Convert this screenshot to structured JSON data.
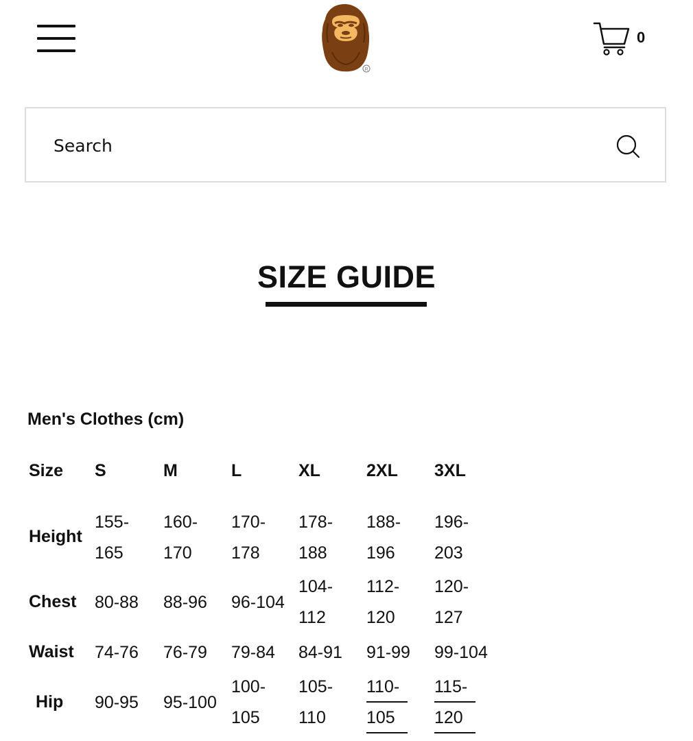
{
  "header": {
    "menu_icon": "hamburger-menu-icon",
    "logo_icon": "ape-head-logo",
    "logo_registered_mark": "®",
    "cart_icon": "shopping-cart-icon",
    "cart_count": "0"
  },
  "search": {
    "placeholder": "Search",
    "icon": "search-icon"
  },
  "page_title": "SIZE GUIDE",
  "section": {
    "heading": "Men's Clothes (cm)"
  },
  "table": {
    "header": [
      "Size",
      "S",
      "M",
      "L",
      "XL",
      "2XL",
      "3XL"
    ],
    "rows": [
      {
        "label": "Height",
        "values": [
          [
            "155-",
            "165"
          ],
          [
            "160-",
            "170"
          ],
          [
            "170-",
            "178"
          ],
          [
            "178-",
            "188"
          ],
          [
            "188-",
            "196"
          ],
          [
            "196-",
            "203"
          ]
        ]
      },
      {
        "label": "Chest",
        "values": [
          [
            "80-88"
          ],
          [
            "88-96"
          ],
          [
            "96-104"
          ],
          [
            "104-",
            "112"
          ],
          [
            "112-",
            "120"
          ],
          [
            "120-",
            "127"
          ]
        ]
      },
      {
        "label": "Waist",
        "values": [
          [
            "74-76"
          ],
          [
            "76-79"
          ],
          [
            "79-84"
          ],
          [
            "84-91"
          ],
          [
            "91-99"
          ],
          [
            "99-104"
          ]
        ]
      },
      {
        "label": "Hip",
        "values": [
          [
            "90-95"
          ],
          [
            "95-100"
          ],
          [
            "100-",
            "105"
          ],
          [
            "105-",
            "110"
          ],
          [
            "110-",
            "105"
          ],
          [
            "115-",
            "120"
          ]
        ]
      }
    ]
  },
  "colors": {
    "text": "#111111",
    "border": "#dcdcdc",
    "logo_brown": "#7a3f12",
    "logo_face": "#f4b860"
  }
}
